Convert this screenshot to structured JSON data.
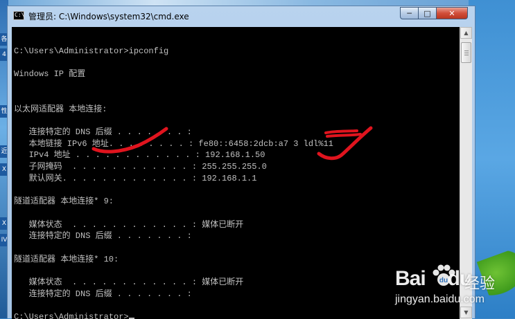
{
  "window": {
    "title": "管理员: C:\\Windows\\system32\\cmd.exe",
    "controls": {
      "minimize": "─",
      "maximize": "□",
      "close": "✕"
    },
    "icon": "cmd-icon"
  },
  "desktop": {
    "left_icons": [
      "各",
      "4",
      "性",
      "近",
      "X",
      "X",
      "IV"
    ]
  },
  "console": {
    "lines": [
      "C:\\Users\\Administrator>ipconfig",
      "",
      "Windows IP 配置",
      "",
      "",
      "以太网适配器 本地连接:",
      "",
      "   连接特定的 DNS 后缀 . . . . . . . :",
      "   本地链接 IPv6 地址. . . . . . . . : fe80::6458:2dcb:a7 3 ldl%11",
      "   IPv4 地址 . . . . . . . . . . . . : 192.168.1.50",
      "   子网掩码  . . . . . . . . . . . . : 255.255.255.0",
      "   默认网关. . . . . . . . . . . . . : 192.168.1.1",
      "",
      "隧道适配器 本地连接* 9:",
      "",
      "   媒体状态  . . . . . . . . . . . . : 媒体已断开",
      "   连接特定的 DNS 后缀 . . . . . . . :",
      "",
      "隧道适配器 本地连接* 10:",
      "",
      "   媒体状态  . . . . . . . . . . . . : 媒体已断开",
      "   连接特定的 DNS 后缀 . . . . . . . :",
      "",
      "C:\\Users\\Administrator>"
    ]
  },
  "watermark": {
    "logo": "Bai",
    "logo_tail": "du",
    "cn": "经验",
    "url": "jingyan.baidu.com"
  },
  "colors": {
    "console_bg": "#000000",
    "console_fg": "#c0c0c0",
    "annotation": "#e0141e"
  }
}
